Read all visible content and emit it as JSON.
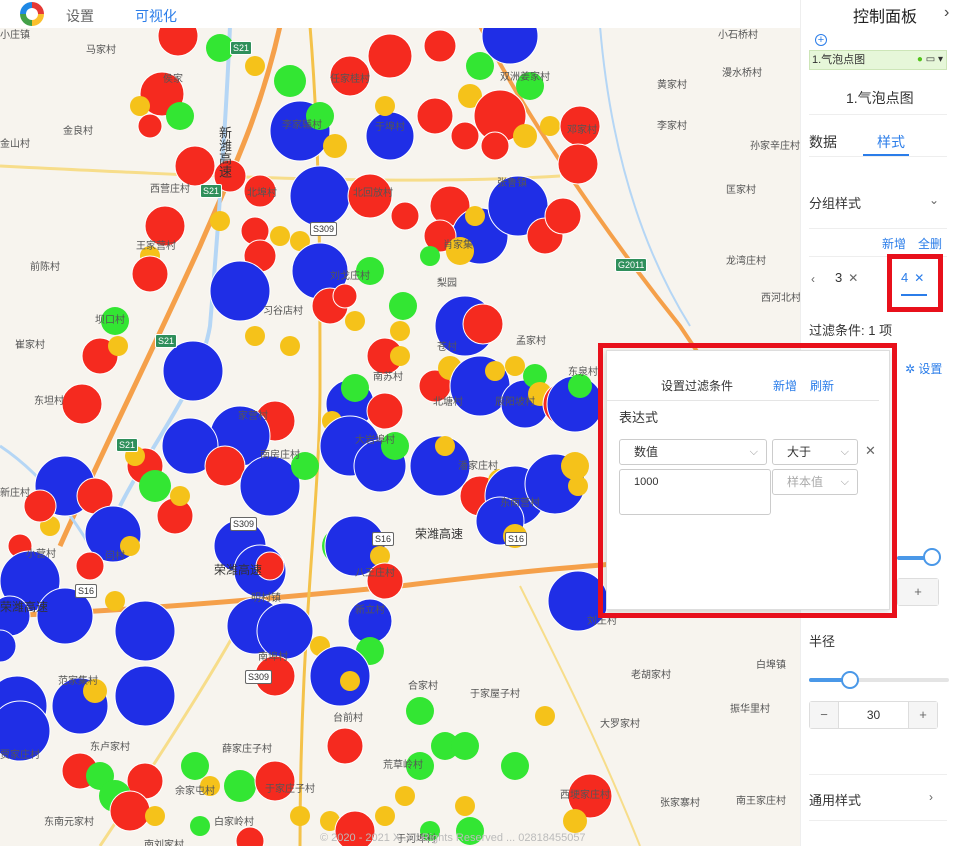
{
  "topbar": {
    "nav": [
      "设置",
      "可视化"
    ],
    "active_index": 1
  },
  "map": {
    "places": [
      {
        "t": "小庄镇"
      },
      {
        "t": "马家村"
      },
      {
        "t": "侯家"
      },
      {
        "t": "任家桂村"
      },
      {
        "t": "双洲姜家村"
      },
      {
        "t": "小石桥村"
      },
      {
        "t": "黄家村"
      },
      {
        "t": "漫水桥村"
      },
      {
        "t": "金山村"
      },
      {
        "t": "金良村"
      },
      {
        "t": "李家辅村"
      },
      {
        "t": "于埠村"
      },
      {
        "t": "邓家村"
      },
      {
        "t": "李家村"
      },
      {
        "t": "孙家辛庄村"
      },
      {
        "t": "西营庄村"
      },
      {
        "t": "北埠村"
      },
      {
        "t": "北回放村"
      },
      {
        "t": "张鲁镇"
      },
      {
        "t": "匡家村"
      },
      {
        "t": "王家营村"
      },
      {
        "t": "前陈村"
      },
      {
        "t": "刘戈庄村"
      },
      {
        "t": "肖家集"
      },
      {
        "t": "龙湾庄村"
      },
      {
        "t": "梨园"
      },
      {
        "t": "西河北村"
      },
      {
        "t": "坝口村"
      },
      {
        "t": "习谷店村"
      },
      {
        "t": "崔家村"
      },
      {
        "t": "孟家村"
      },
      {
        "t": "苍村"
      },
      {
        "t": "东坦村"
      },
      {
        "t": "南苏村"
      },
      {
        "t": "东泉村"
      },
      {
        "t": "北塘村"
      },
      {
        "t": "辰阳坡村"
      },
      {
        "t": "家营村"
      },
      {
        "t": "大岩埠村"
      },
      {
        "t": "南房庄村"
      },
      {
        "t": "潘家庄村"
      },
      {
        "t": "新庄村"
      },
      {
        "t": "东南营村"
      },
      {
        "t": "八王庄村"
      },
      {
        "t": "小营村"
      },
      {
        "t": "闫村"
      },
      {
        "t": "明村镇"
      },
      {
        "t": "新立村"
      },
      {
        "t": "南埠村"
      },
      {
        "t": "范家集村"
      },
      {
        "t": "老胡家村"
      },
      {
        "t": "白埠镇"
      },
      {
        "t": "合家村"
      },
      {
        "t": "于家屋子村"
      },
      {
        "t": "振华里村"
      },
      {
        "t": "大罗家村"
      },
      {
        "t": "台前村"
      },
      {
        "t": "东卢家村"
      },
      {
        "t": "薛家庄子村"
      },
      {
        "t": "荒草岭村"
      },
      {
        "t": "于家庄子村"
      },
      {
        "t": "西埂家庄村"
      },
      {
        "t": "张家寨村"
      },
      {
        "t": "南王家庄村"
      },
      {
        "t": "贾家庄村"
      },
      {
        "t": "余家屯村"
      },
      {
        "t": "白家岭村"
      },
      {
        "t": "东南元家村"
      },
      {
        "t": "南刘家村"
      },
      {
        "t": "于河埠村"
      },
      {
        "t": "刘王村"
      },
      {
        "t": "新潍高速"
      }
    ],
    "road_labels": [
      "荣潍高速",
      "荣潍高速",
      "荣潍高速"
    ],
    "shields": [
      {
        "t": "S21"
      },
      {
        "t": "S21"
      },
      {
        "t": "S21"
      },
      {
        "t": "S21"
      },
      {
        "t": "S309"
      },
      {
        "t": "S309"
      },
      {
        "t": "S309"
      },
      {
        "t": "S16"
      },
      {
        "t": "S16"
      },
      {
        "t": "S16"
      },
      {
        "t": "G2011"
      }
    ],
    "copyright": "© 2020 - 2021 X..All Rights Reserved ... 02818455057",
    "colors": {
      "red": "#f52a1f",
      "blue": "#1f2ee6",
      "green": "#33e633",
      "yellow": "#f5c21a"
    }
  },
  "panel": {
    "title": "控制面板",
    "close_glyph": "›",
    "add_glyph": "+",
    "layer_row": "1.气泡点图",
    "layer_name": "1.气泡点图",
    "tabs": [
      "数据",
      "样式"
    ],
    "active_tab": 1,
    "group_style_label": "分组样式",
    "add_link": "新增",
    "delete_all_link": "全删",
    "group_tabs": [
      "3",
      "4"
    ],
    "active_group": 1,
    "filter_label": "过滤条件: 1 项",
    "settings_link": "设置",
    "radius_label": "半径",
    "radius_value": "30",
    "common_style_label": "通用样式"
  },
  "popup": {
    "title": "设置过滤条件",
    "add_link": "新增",
    "refresh_link": "刷新",
    "expr_label": "表达式",
    "field_select": "数值",
    "operator_select": "大于",
    "value_text": "1000",
    "sample_placeholder": "样本值"
  }
}
